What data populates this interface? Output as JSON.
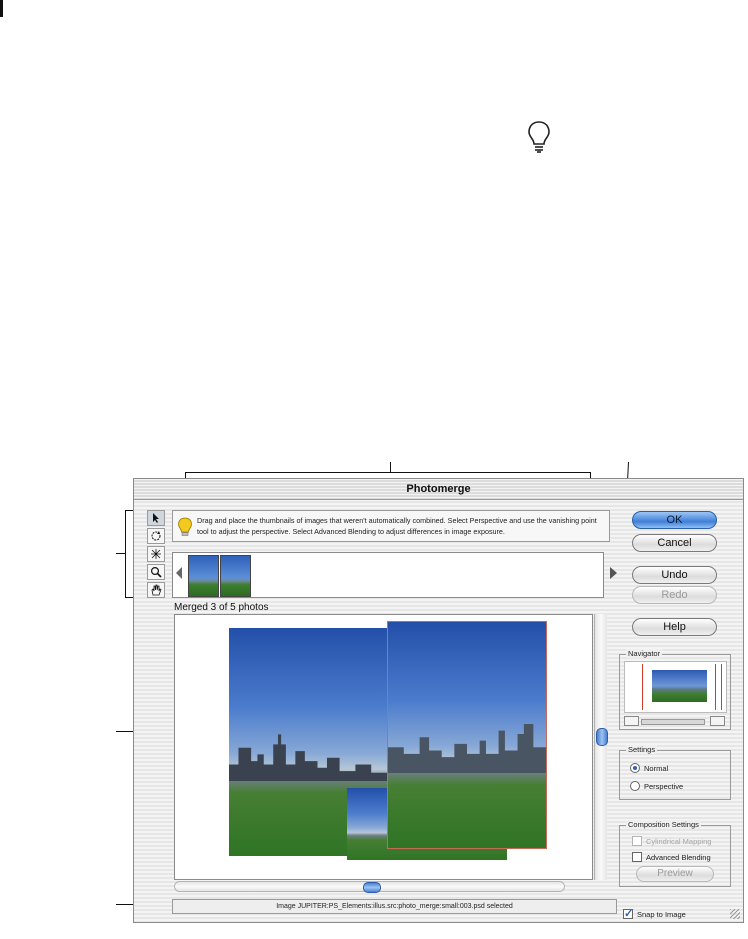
{
  "window": {
    "title": "Photomerge"
  },
  "hint": {
    "text": "Drag and place the thumbnails of images that weren't automatically combined.  Select Perspective and use the vanishing point tool to adjust the perspective.  Select Advanced Blending to adjust differences in image exposure."
  },
  "tools": [
    {
      "name": "select-image-tool-icon"
    },
    {
      "name": "rotate-image-tool-icon"
    },
    {
      "name": "vanishing-point-tool-icon"
    },
    {
      "name": "zoom-tool-icon"
    },
    {
      "name": "hand-tool-icon"
    }
  ],
  "lightbox": {
    "thumbnail_count": 2
  },
  "work_area": {
    "merged_label": "Merged 3 of 5 photos"
  },
  "status": {
    "text": "Image JUPITER:PS_Elements:illus.src:photo_merge:small:003.psd selected"
  },
  "buttons": {
    "ok": "OK",
    "cancel": "Cancel",
    "undo": "Undo",
    "redo": "Redo",
    "help": "Help",
    "preview": "Preview"
  },
  "navigator": {
    "title": "Navigator"
  },
  "settings": {
    "title": "Settings",
    "normal": "Normal",
    "perspective": "Perspective",
    "selected": "Normal"
  },
  "composition": {
    "title": "Composition Settings",
    "cylindrical": "Cylindrical Mapping",
    "advanced": "Advanced Blending"
  },
  "snap": {
    "label": "Snap to Image",
    "checked": true
  },
  "colors": {
    "accent": "#3f7fd6",
    "selection_outline": "#c66a5a"
  }
}
